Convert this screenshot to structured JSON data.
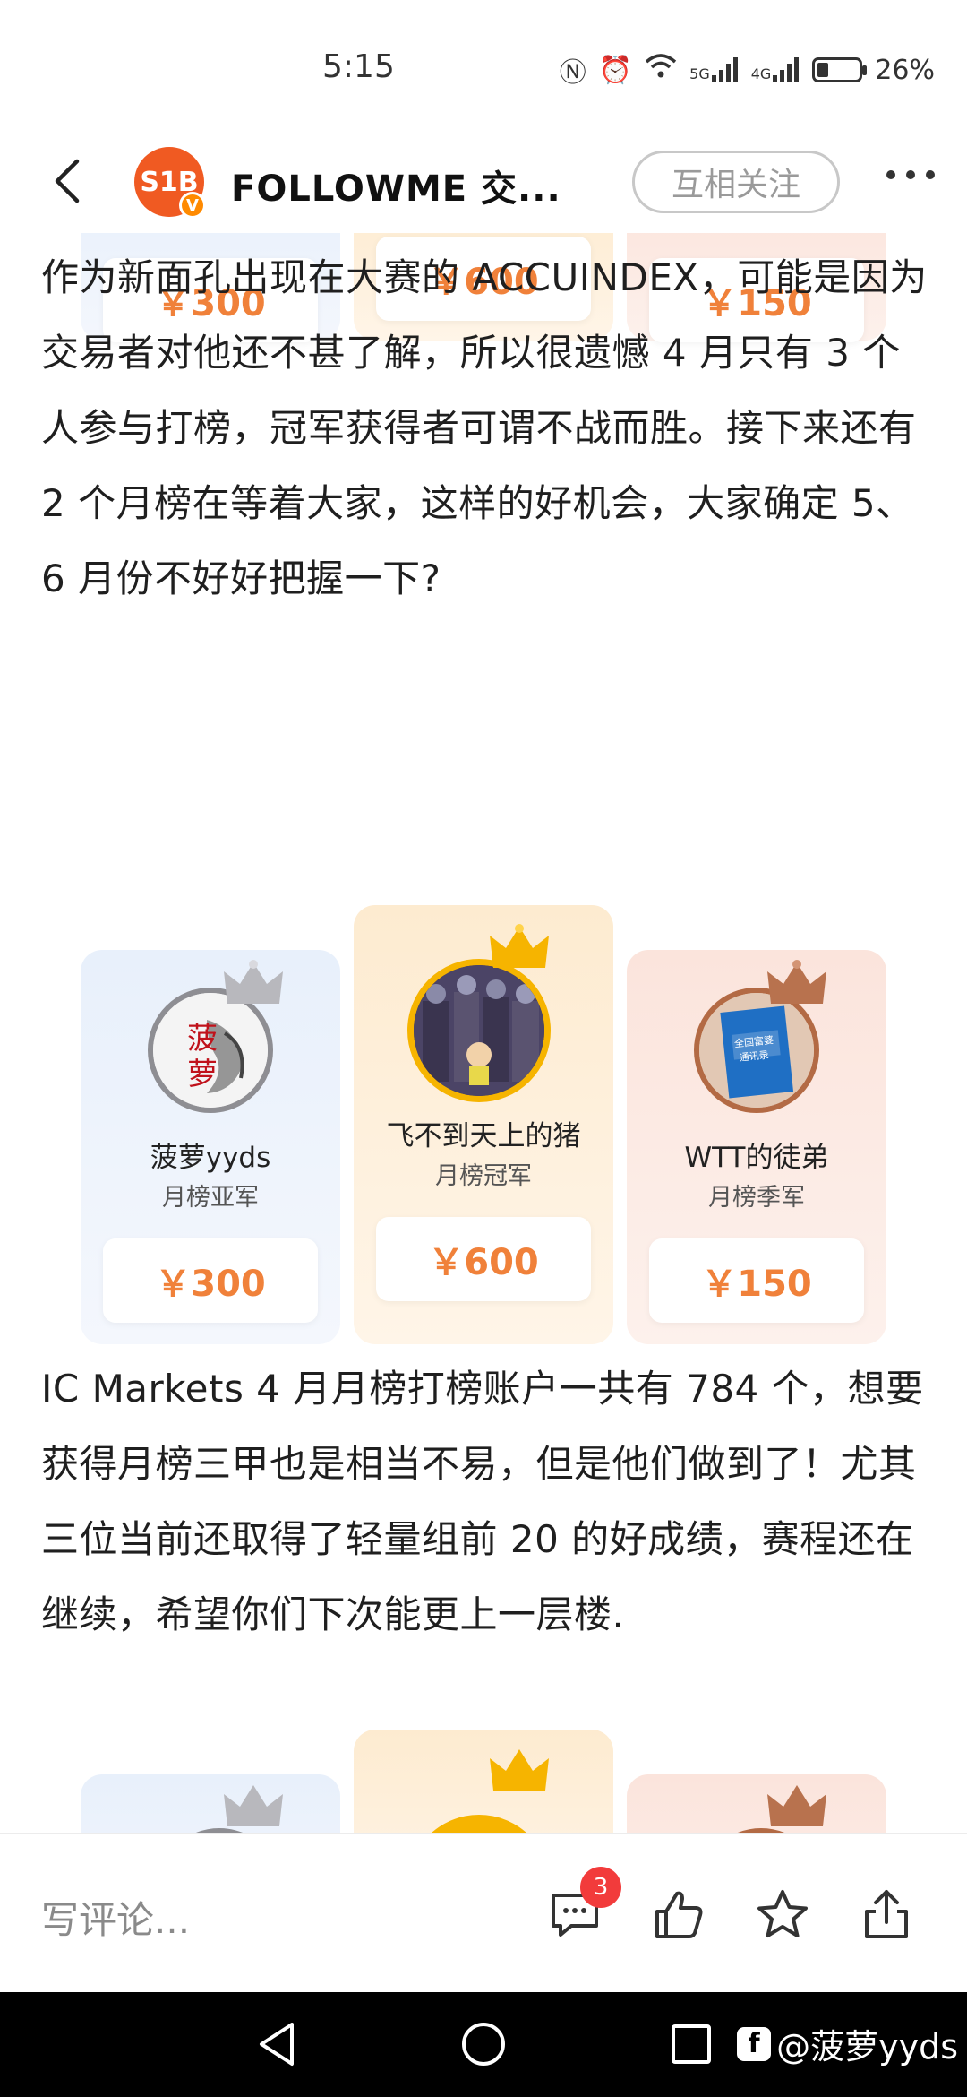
{
  "status_bar": {
    "time": "5:15",
    "network_5g": "5G",
    "network_4g": "4G",
    "battery": "26%",
    "battery_level": 0.26
  },
  "header": {
    "logo_text": "S1B",
    "title": "FOLLOWME 交...",
    "follow_label": "互相关注"
  },
  "podium_top": {
    "prizes": [
      "￥300",
      "￥600",
      "￥150"
    ]
  },
  "paragraph_1": "作为新面孔出现在大赛的 ACCUINDEX，可能是因为交易者对他还不甚了解，所以很遗憾 4 月只有 3 个人参与打榜，冠军获得者可谓不战而胜。接下来还有 2 个月榜在等着大家，这样的好机会，大家确定 5、6 月份不好好把握一下?",
  "podium_main": {
    "silver": {
      "name": "菠萝yyds",
      "rank": "月榜亚军",
      "prize": "￥300",
      "avatar_text": "菠萝"
    },
    "gold": {
      "name": "飞不到天上的猪",
      "rank": "月榜冠军",
      "prize": "￥600"
    },
    "bronze": {
      "name": "WTT的徒弟",
      "rank": "月榜季军",
      "prize": "￥150",
      "avatar_text": "全国富婆通讯录"
    }
  },
  "paragraph_2": "IC Markets 4 月月榜打榜账户一共有 784 个，想要获得月榜三甲也是相当不易，但是他们做到了！尤其三位当前还取得了轻量组前 20 的好成绩，赛程还在继续，希望你们下次能更上一层楼.",
  "bottom_bar": {
    "comment_placeholder": "写评论...",
    "comment_count": "3"
  },
  "watermark": {
    "text": "@菠萝yyds"
  },
  "colors": {
    "accent": "#f0813a",
    "brand": "#f05a22",
    "badge": "#f23b3b"
  }
}
